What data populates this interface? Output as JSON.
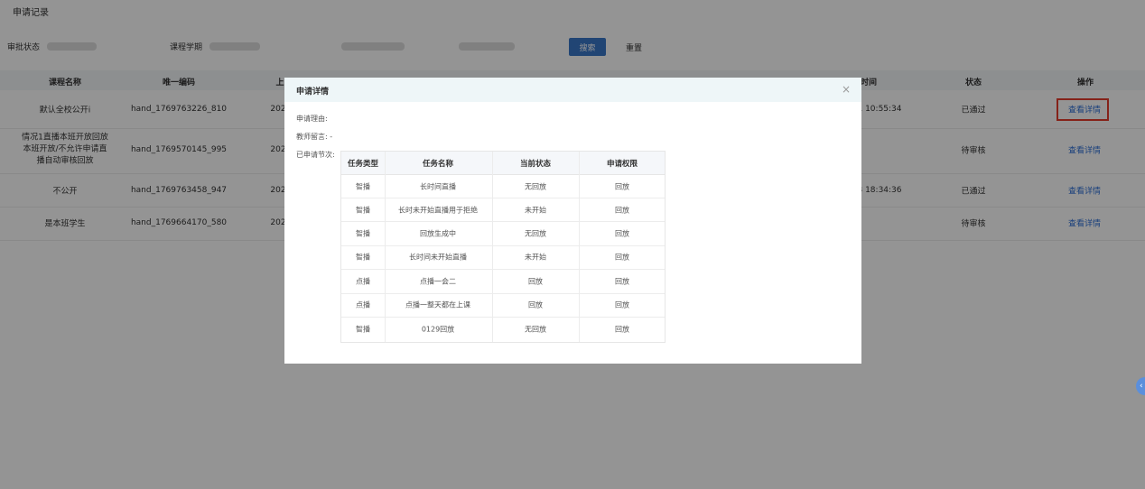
{
  "page": {
    "title": "申请记录"
  },
  "filters": {
    "status_label": "审批状态",
    "term_label": "课程学期",
    "search_button": "搜索",
    "reset_button": "重置"
  },
  "table": {
    "columns": [
      "课程名称",
      "唯一编码",
      "上",
      "时间",
      "状态",
      "操作"
    ],
    "rows": [
      {
        "course": "默认全校公开i",
        "code": "hand_1769763226_810",
        "date_prefix": "202",
        "time": "1 10:55:34",
        "status": "已通过",
        "action": "查看详情"
      },
      {
        "course": "情况1直播本班开放回放本班开放/不允许申请直播自动审核回放",
        "code": "hand_1769570145_995",
        "date_prefix": "202",
        "time": "",
        "status": "待审核",
        "action": "查看详情"
      },
      {
        "course": "不公开",
        "code": "hand_1769763458_947",
        "date_prefix": "202",
        "time": "3 18:34:36",
        "status": "已通过",
        "action": "查看详情"
      },
      {
        "course": "是本班学生",
        "code": "hand_1769664170_580",
        "date_prefix": "202",
        "time": "",
        "status": "待审核",
        "action": "查看详情"
      }
    ]
  },
  "modal": {
    "title": "申请详情",
    "close": "×",
    "reason_label": "申请理由:",
    "teacher_note_label": "教师留言: -",
    "sessions_label": "已申请节次:",
    "columns": [
      "任务类型",
      "任务名称",
      "当前状态",
      "申请权限"
    ],
    "rows": [
      [
        "智播",
        "长时间直播",
        "无回放",
        "回放"
      ],
      [
        "智播",
        "长时未开始直播用于拒绝",
        "未开始",
        "回放"
      ],
      [
        "智播",
        "回放生成中",
        "无回放",
        "回放"
      ],
      [
        "智播",
        "长时间未开始直播",
        "未开始",
        "回放"
      ],
      [
        "点播",
        "点播一会二",
        "回放",
        "回放"
      ],
      [
        "点播",
        "点播一整天都在上课",
        "回放",
        "回放"
      ],
      [
        "智播",
        "0129回放",
        "无回放",
        "回放"
      ]
    ]
  },
  "float_button": {
    "icon": "chevron-left-icon",
    "glyph": "‹"
  },
  "colors": {
    "primary": "#3a77c8",
    "link": "#2d6fd6",
    "highlight": "#e53b2c",
    "modal_header": "#eef6f8"
  }
}
